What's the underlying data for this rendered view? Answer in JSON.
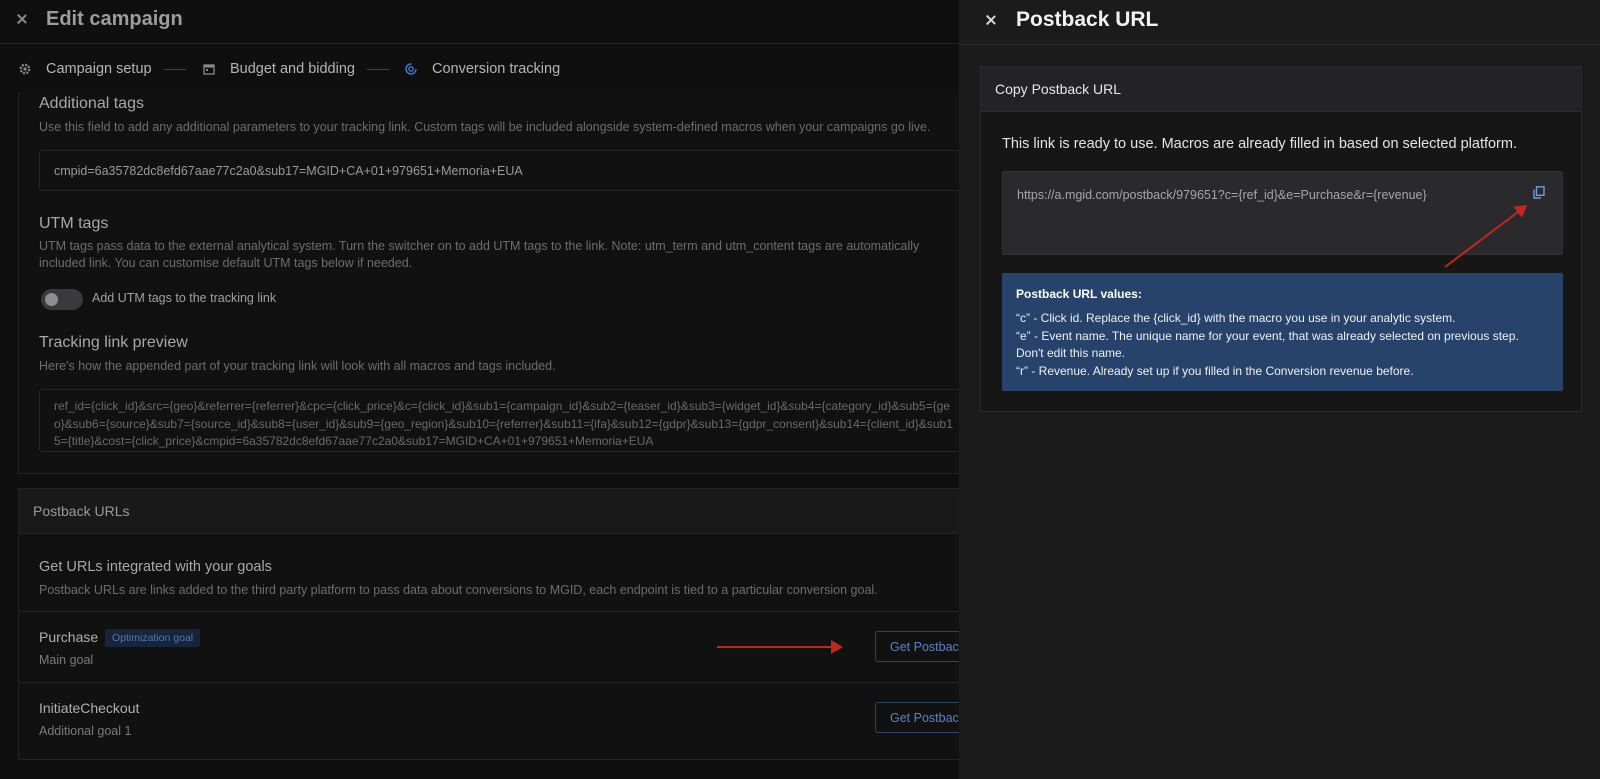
{
  "header": {
    "title": "Edit campaign"
  },
  "steps": [
    {
      "label": "Campaign setup",
      "icon": "gear-icon"
    },
    {
      "label": "Budget and bidding",
      "icon": "calendar-icon"
    },
    {
      "label": "Conversion tracking",
      "icon": "target-icon",
      "accent": "#3b7ad9"
    }
  ],
  "additional_tags": {
    "title": "Additional tags",
    "description": "Use this field to add any additional parameters to your tracking link. Custom tags will be included alongside system-defined macros when your campaigns go live.",
    "value": "cmpid=6a35782dc8efd67aae77c2a0&sub17=MGID+CA+01+979651+Memoria+EUA"
  },
  "utm_tags": {
    "title": "UTM tags",
    "description": "UTM tags pass data to the external analytical system. Turn the switcher on to add UTM tags to the link. Note: utm_term and utm_content tags are automatically included link. You can customise default UTM tags below if needed.",
    "toggle_label": "Add UTM tags to the tracking link",
    "toggle_on": false
  },
  "preview": {
    "title": "Tracking link preview",
    "description": "Here's how the appended part of your tracking link will look with all macros and tags included.",
    "value": "ref_id={click_id}&src={geo}&referrer={referrer}&cpc={click_price}&c={click_id}&sub1={campaign_id}&sub2={teaser_id}&sub3={widget_id}&sub4={category_id}&sub5={geo}&sub6={source}&sub7={source_id}&sub8={user_id}&sub9={geo_region}&sub10={referrer}&sub11={ifa}&sub12={gdpr}&sub13={gdpr_consent}&sub14={client_id}&sub15={title}&cost={click_price}&cmpid=6a35782dc8efd67aae77c2a0&sub17=MGID+CA+01+979651+Memoria+EUA"
  },
  "postback_urls": {
    "header": "Postback URLs",
    "title": "Get URLs integrated with your goals",
    "description": "Postback URLs are links added to the third party platform to pass data about conversions to MGID, each endpoint is tied to a particular conversion goal.",
    "goals": [
      {
        "name": "Purchase",
        "badge": "Optimization goal",
        "sub": "Main goal",
        "button": "Get Postback URL"
      },
      {
        "name": "InitiateCheckout",
        "badge": "",
        "sub": "Additional goal 1",
        "button": "Get Postback URL"
      }
    ]
  },
  "drawer": {
    "title": "Postback URL",
    "card_title": "Copy Postback URL",
    "ready_text": "This link is ready to use. Macros are already filled in based on selected platform.",
    "url": "https://a.mgid.com/postback/979651?c={ref_id}&e=Purchase&r={revenue}",
    "info_title": "Postback URL values:",
    "info_lines": [
      "“c” - Click id. Replace the {click_id} with the macro you use in your analytic system.",
      "“e” - Event name. The unique name for your event, that was already selected on previous step. Don't edit this name.",
      "“r” - Revenue. Already set up if you filled in the Conversion revenue before."
    ],
    "info_bg": "#27436b"
  }
}
